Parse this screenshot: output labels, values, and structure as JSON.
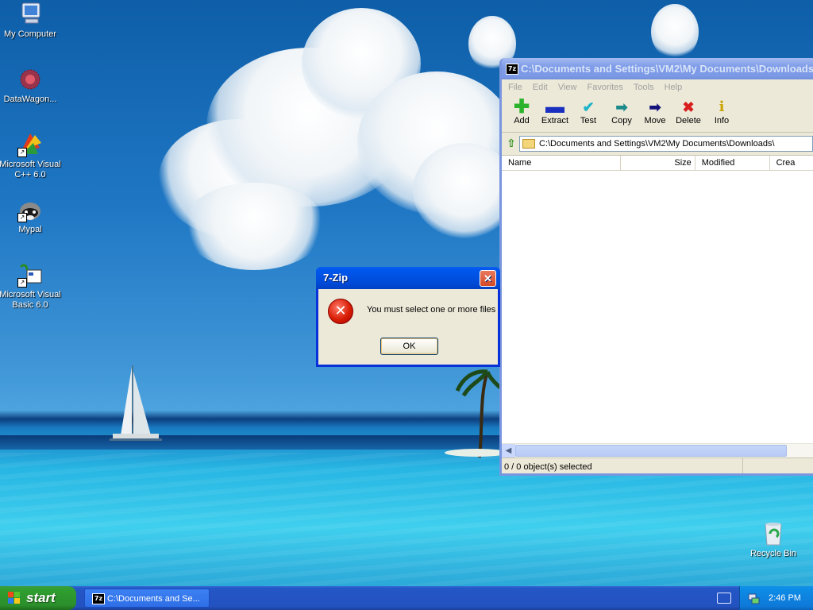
{
  "desktop": {
    "icons": [
      {
        "label": "My Computer",
        "icon": "my-computer-icon"
      },
      {
        "label": "DataWagon...",
        "icon": "datawagon-icon"
      },
      {
        "label": "Microsoft Visual C++ 6.0",
        "icon": "visual-cpp-icon"
      },
      {
        "label": "Mypal",
        "icon": "mypal-icon"
      },
      {
        "label": "Microsoft Visual Basic 6.0",
        "icon": "visual-basic-icon"
      },
      {
        "label": "Recycle Bin",
        "icon": "recycle-bin-icon"
      }
    ]
  },
  "zip_window": {
    "app_icon": "7z",
    "title": "C:\\Documents and Settings\\VM2\\My Documents\\Downloads\\",
    "menu": [
      "File",
      "Edit",
      "View",
      "Favorites",
      "Tools",
      "Help"
    ],
    "toolbar": [
      {
        "label": "Add",
        "icon": "add-icon",
        "color": "#2bb32b"
      },
      {
        "label": "Extract",
        "icon": "extract-icon",
        "color": "#1a2fbf"
      },
      {
        "label": "Test",
        "icon": "test-icon",
        "color": "#1fb3c9"
      },
      {
        "label": "Copy",
        "icon": "copy-icon",
        "color": "#1a8a8a"
      },
      {
        "label": "Move",
        "icon": "move-icon",
        "color": "#12127a"
      },
      {
        "label": "Delete",
        "icon": "delete-icon",
        "color": "#d81e1e"
      },
      {
        "label": "Info",
        "icon": "info-icon",
        "color": "#c9a300"
      }
    ],
    "address": "C:\\Documents and Settings\\VM2\\My Documents\\Downloads\\",
    "columns": [
      "Name",
      "Size",
      "Modified",
      "Crea"
    ],
    "status": "0 / 0 object(s) selected"
  },
  "dialog": {
    "title": "7-Zip",
    "close": "✕",
    "message": "You must select one or more files",
    "ok_label": "OK",
    "icon": "error-icon"
  },
  "taskbar": {
    "start_label": "start",
    "task_label": "C:\\Documents and Se...",
    "clock": "2:46 PM"
  }
}
